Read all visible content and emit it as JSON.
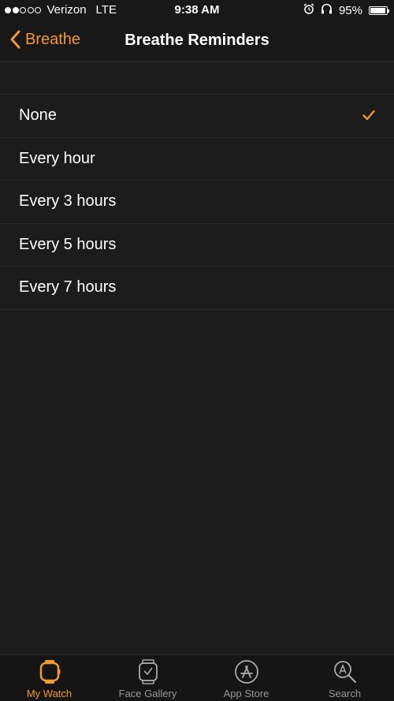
{
  "status_bar": {
    "carrier": "Verizon",
    "network": "LTE",
    "time": "9:38 AM",
    "battery": "95%",
    "battery_level": 0.95,
    "signal_bars_filled": 2,
    "signal_bars_total": 5
  },
  "nav": {
    "back_label": "Breathe",
    "title": "Breathe Reminders"
  },
  "options": [
    {
      "label": "None",
      "selected": true
    },
    {
      "label": "Every hour",
      "selected": false
    },
    {
      "label": "Every 3 hours",
      "selected": false
    },
    {
      "label": "Every 5 hours",
      "selected": false
    },
    {
      "label": "Every 7 hours",
      "selected": false
    }
  ],
  "tabs": [
    {
      "label": "My Watch",
      "icon": "watch-icon",
      "active": true
    },
    {
      "label": "Face Gallery",
      "icon": "face-gallery-icon",
      "active": false
    },
    {
      "label": "App Store",
      "icon": "app-store-icon",
      "active": false
    },
    {
      "label": "Search",
      "icon": "search-icon",
      "active": false
    }
  ],
  "colors": {
    "accent": "#f39a2b",
    "background": "#1c1c1c",
    "bar": "#181818"
  }
}
